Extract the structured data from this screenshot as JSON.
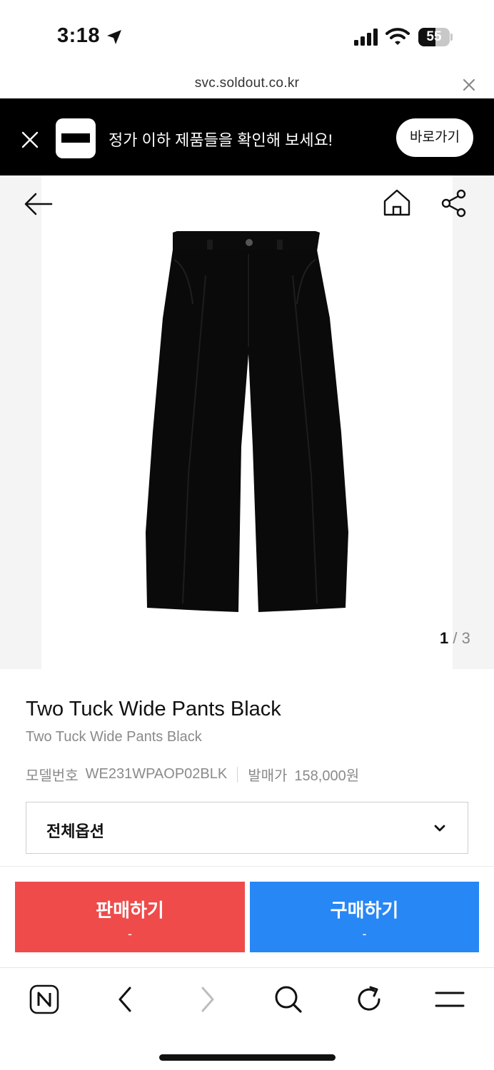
{
  "status_bar": {
    "time": "3:18",
    "battery_level": "55",
    "battery_fraction": 0.55,
    "icons": [
      "location-arrow-icon",
      "cellular-signal-icon",
      "wifi-icon",
      "battery-icon"
    ]
  },
  "browser": {
    "url": "svc.soldout.co.kr"
  },
  "app_banner": {
    "message": "정가 이하 제품들을 확인해 보세요!",
    "button_label": "바로가기"
  },
  "gallery": {
    "current_page": "1",
    "separator": "/",
    "total_pages": "3"
  },
  "product": {
    "title": "Two Tuck Wide Pants Black",
    "subtitle": "Two Tuck Wide Pants Black",
    "model_label": "모델번호",
    "model_value": "WE231WPAOP02BLK",
    "price_label": "발매가",
    "price_value": "158,000원"
  },
  "options": {
    "selected": "전체옵션"
  },
  "actions": {
    "sell_label": "판매하기",
    "sell_price": "-",
    "buy_label": "구매하기",
    "buy_price": "-"
  },
  "colors": {
    "sell": "#ef4b4b",
    "buy": "#2787f5",
    "banner": "#000000"
  }
}
